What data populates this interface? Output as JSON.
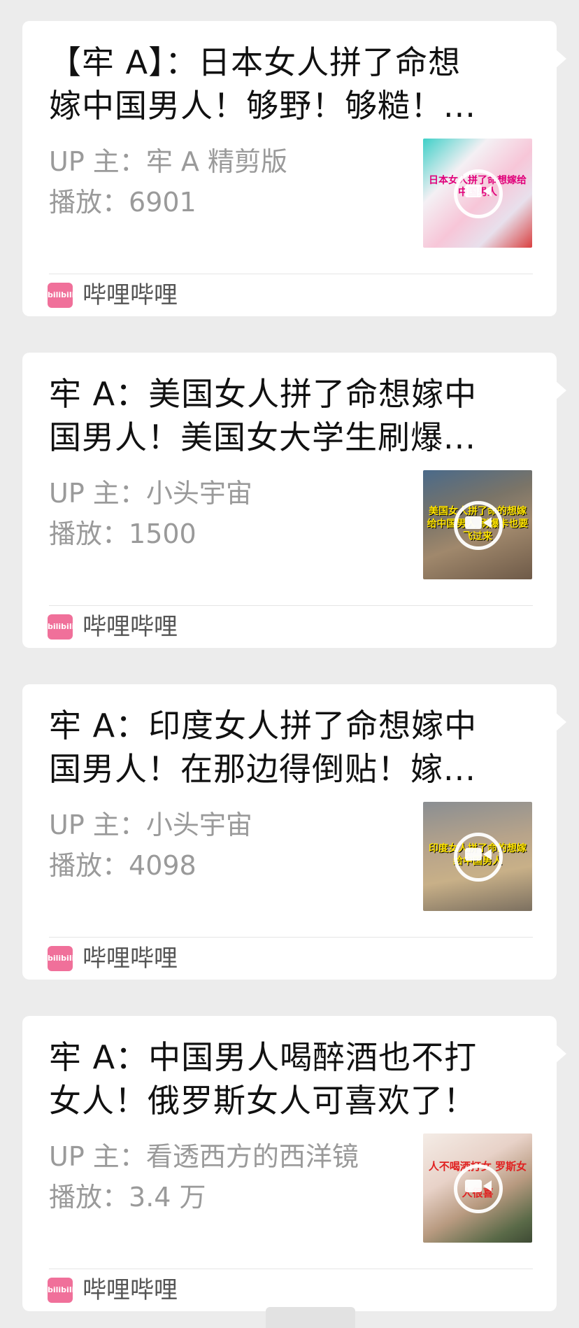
{
  "source": {
    "name": "哔哩哔哩",
    "logo_text": "bilibili"
  },
  "colors": {
    "background": "#ececec",
    "card": "#ffffff",
    "title": "#111111",
    "meta": "#9a9a9a",
    "source_logo": "#f0709a"
  },
  "cards": [
    {
      "title_line1": "【牢 A】：日本女人拼了命想",
      "title_line2": "嫁中国男人！够野！够糙！...",
      "up_label": "UP 主：",
      "up_value": "牢 A 精剪版",
      "plays_label": "播放：",
      "plays_value": "6901",
      "thumb_caption": "日本女人拼了命想嫁给中国男人",
      "play_icon": "video-camera-icon"
    },
    {
      "title_line1": "牢 A：美国女人拼了命想嫁中",
      "title_line2": "国男人！美国女大学生刷爆...",
      "up_label": "UP 主：",
      "up_value": "小头宇宙",
      "plays_label": "播放：",
      "plays_value": "1500",
      "thumb_caption": "美国女人拼了命的想嫁给中国男人 刷爆卡也要飞过来",
      "play_icon": "video-camera-icon"
    },
    {
      "title_line1": "牢 A：印度女人拼了命想嫁中",
      "title_line2": "国男人！在那边得倒贴！嫁...",
      "up_label": "UP 主：",
      "up_value": "小头宇宙",
      "plays_label": "播放：",
      "plays_value": "4098",
      "thumb_caption": "印度女人拼了命的想嫁给中国男人",
      "play_icon": "video-camera-icon"
    },
    {
      "title_line1": "牢 A：中国男人喝醉酒也不打",
      "title_line2": "女人！俄罗斯女人可喜欢了！",
      "up_label": "UP 主：",
      "up_value": "看透西方的西洋镜",
      "plays_label": "播放：",
      "plays_value": "3.4 万",
      "thumb_caption": "人不喝酒打女 罗斯女人很喜",
      "play_icon": "video-camera-icon"
    }
  ]
}
